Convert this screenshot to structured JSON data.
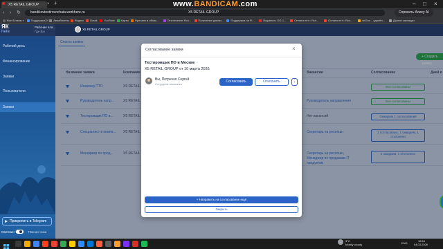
{
  "browser": {
    "tab_title": "X5 RETAIL GROUP",
    "url": "bandikovtestirovochaia.workhere.ru",
    "page_title": "X5 RETAIL GROUP",
    "ask_alisa": "Спросить Алису AI",
    "bookmarks": [
      "Все ботаны «",
      "Поддержка24",
      "Авиабилеты",
      "Яндекс",
      "Gmail",
      "YouTube",
      "Карты",
      "Фриланс в облас...",
      "Отключение Ясп...",
      "Получение данны...",
      "Поддержка на FI...",
      "Bogdanov, OG-1...",
      "Оплата нет • Ясп...",
      "Оплата нет • Ясп...",
      "deGoo – удалён...",
      "Другие закладки"
    ],
    "bookmark_colors": [
      "#5f6368",
      "#4a8af4",
      "#888888",
      "#fc3f1d",
      "#ea4335",
      "#ff0000",
      "#34a853",
      "#e37400",
      "#a142f4",
      "#ea4335",
      "#4285f4",
      "#d93025",
      "#ea4335",
      "#ea4335",
      "#f9ab00",
      "#9aa0a6"
    ]
  },
  "watermark": {
    "prefix": "www.",
    "brand": "BANDICAM",
    "suffix": ".com"
  },
  "app": {
    "logo_top": "ЯК",
    "logo_bottom": "here",
    "plan_line1": "Рабочая пла...",
    "plan_line2": "Где Вы",
    "company": "X5 RETAIL GROUP",
    "sidebar": [
      {
        "label": "Рабочий день",
        "active": false
      },
      {
        "label": "Финансирование",
        "active": false
      },
      {
        "label": "Заявки",
        "active": false
      },
      {
        "label": "Пользователи",
        "active": false
      },
      {
        "label": "Заявки",
        "active": true
      }
    ],
    "telegram_button": "Прикрепить в Telegram",
    "theme_light": "Светлая тема",
    "theme_dark": "Тёмная тема",
    "main_tab": "Список заявок",
    "create_button": "+ Создать заявку",
    "table": {
      "headers": [
        "Название заявки",
        "Компания",
        "Вакансии",
        "Согласование",
        "Дней в"
      ],
      "rows": [
        {
          "name": "Инженер ПТО",
          "company": "X5 RETAIL",
          "vacancy": "",
          "status": "Все согласованы",
          "status_type": "green"
        },
        {
          "name": "Руководитель напр...",
          "company": "X5 RETAIL",
          "vacancy": "Руководитель направления",
          "status": "Все согласованы",
          "status_type": "green"
        },
        {
          "name": "Тестировщик ПО в...",
          "company": "X5 RETAIL",
          "vacancy": "Нет вакансий",
          "status": "Ожидаем 1 согласования",
          "status_type": "blue"
        },
        {
          "name": "Специалист в компа...",
          "company": "X5 RETAIL",
          "vacancy": "Секретарь на ресепшн",
          "status": "1 согласовано, 1 ожидаем, 1 отклонено",
          "status_type": "mixed"
        },
        {
          "name": "Менеджер по прод...",
          "company": "X5 RETAIL",
          "vacancy": "Секретарь на ресепшн, Менеджер по продажам IT продуктам",
          "status": "2 ожидаем, 1 отклонено",
          "status_type": "mixed"
        }
      ]
    }
  },
  "modal": {
    "title": "Согласование заявки",
    "heading": "Тестировщик ПО в Москве",
    "subheading": "X5 RETAIL GROUP от 10 марта 2026",
    "approver_name": "Вы, Петренко Сергей",
    "approver_role": "Сотрудник заказчика",
    "approve_label": "Согласовать",
    "reject_label": "Отклонить",
    "more_label": "⋮",
    "send_label": "+ Направить на согласование ещё",
    "close_label": "Закрыть",
    "close_icon": "×"
  },
  "taskbar": {
    "weather_temp": "3°C",
    "weather_desc": "Mostly cloudy",
    "lang": "ENG",
    "time": "16:54",
    "date": "04.03.2026"
  }
}
